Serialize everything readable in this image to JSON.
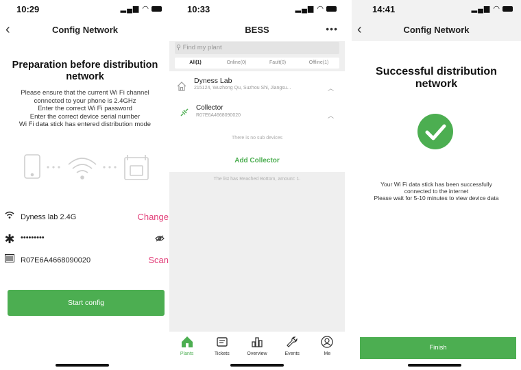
{
  "screen1": {
    "status": {
      "time": "10:29"
    },
    "nav": {
      "back": "‹",
      "title": "Config Network"
    },
    "heading": "Preparation before distribution network",
    "instructions": [
      "Please ensure that the current Wi Fi channel",
      "connected to your phone is 2.4GHz",
      "Enter the correct Wi Fi password",
      "Enter the correct device serial number",
      "Wi Fi data stick has entered distribution mode"
    ],
    "wifi": {
      "ssid": "Dyness lab 2.4G",
      "change_label": "Change"
    },
    "password": {
      "masked": "•••••••••"
    },
    "serial": {
      "value": "R07E6A4668090020",
      "scan_label": "Scan"
    },
    "start_button": "Start config"
  },
  "screen2": {
    "status": {
      "time": "10:33"
    },
    "nav": {
      "title": "BESS",
      "more": "•••"
    },
    "search": {
      "placeholder": "Find my plant"
    },
    "tabs": [
      {
        "label": "All(1)",
        "active": true
      },
      {
        "label": "Online(0)"
      },
      {
        "label": "Fault(0)"
      },
      {
        "label": "Offline(1)"
      }
    ],
    "plant": {
      "name": "Dyness Lab",
      "address": "215124, Wuzhong Qu, Suzhou Shi, Jiangsu..."
    },
    "collector": {
      "name": "Collector",
      "serial": "R07E6A4668090020"
    },
    "no_sub_devices": "There is no sub devices",
    "add_collector": "Add Collector",
    "list_bottom": "The list has Reached Bottom, amount: 1.",
    "tabbar": [
      {
        "label": "Plants",
        "icon": "home-icon",
        "active": true
      },
      {
        "label": "Tickets",
        "icon": "ticket-icon"
      },
      {
        "label": "Overview",
        "icon": "chart-icon"
      },
      {
        "label": "Events",
        "icon": "wrench-icon"
      },
      {
        "label": "Me",
        "icon": "user-icon"
      }
    ],
    "accent_color": "#4cae51"
  },
  "screen3": {
    "status": {
      "time": "14:41"
    },
    "nav": {
      "back": "‹",
      "title": "Config Network"
    },
    "heading": "Successful distribution network",
    "message": [
      "Your Wi Fi data stick has been successfully",
      "connected to the internet",
      "Please wait for 5-10 minutes to view device data"
    ],
    "finish_button": "Finish"
  }
}
